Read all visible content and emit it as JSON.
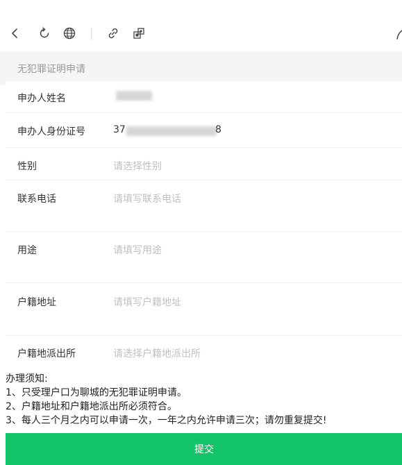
{
  "toolbar": {
    "buttons": [
      {
        "name": "back-icon"
      },
      {
        "name": "refresh-icon"
      },
      {
        "name": "globe-icon"
      },
      {
        "name": "link-icon"
      },
      {
        "name": "qr-code-icon"
      }
    ]
  },
  "section": {
    "title": "无犯罪证明申请"
  },
  "form": {
    "applicant_name": {
      "label": "申办人姓名",
      "value": ""
    },
    "applicant_id": {
      "label": "申办人身份证号",
      "value_prefix": "37",
      "value_suffix": "8"
    },
    "gender": {
      "label": "性别",
      "placeholder": "请选择性别"
    },
    "phone": {
      "label": "联系电话",
      "placeholder": "请填写联系电话"
    },
    "purpose": {
      "label": "用途",
      "placeholder": "请填写用途"
    },
    "household_address": {
      "label": "户籍地址",
      "placeholder": "请填写户籍地址"
    },
    "police_station": {
      "label": "户籍地派出所",
      "placeholder": "请选择户籍地派出所"
    }
  },
  "notice": {
    "title": "办理须知:",
    "lines": [
      "1、只受理户口为聊城的无犯罪证明申请。",
      "2、户籍地址和户籍地派出所必须符合。",
      "3、每人三个月之内可以申请一次，一年之内允许申请三次；请勿重复提交!"
    ]
  },
  "submit": {
    "label": "提交"
  },
  "colors": {
    "accent": "#13c56a",
    "placeholder": "#c0c0c0",
    "band": "#f5f5f5"
  }
}
